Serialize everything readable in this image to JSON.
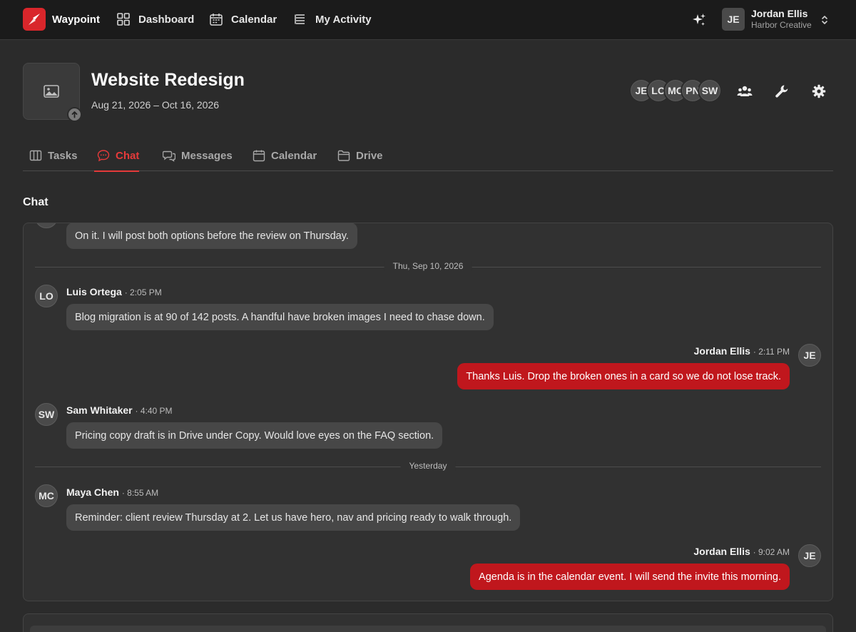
{
  "app": {
    "name": "Waypoint"
  },
  "nav": {
    "dashboard": "Dashboard",
    "calendar": "Calendar",
    "activity": "My Activity"
  },
  "user": {
    "initials": "JE",
    "name": "Jordan Ellis",
    "org": "Harbor Creative"
  },
  "project": {
    "title": "Website Redesign",
    "dates": "Aug 21, 2026 – Oct 16, 2026",
    "members": [
      "JE",
      "LO",
      "MC",
      "PN",
      "SW"
    ]
  },
  "tabs": [
    {
      "label": "Tasks",
      "icon": "columns-icon"
    },
    {
      "label": "Chat",
      "icon": "chat-icon",
      "active": true
    },
    {
      "label": "Messages",
      "icon": "messages-icon"
    },
    {
      "label": "Calendar",
      "icon": "calendar-icon"
    },
    {
      "label": "Drive",
      "icon": "folder-icon"
    }
  ],
  "chat": {
    "title": "Chat",
    "messages": [
      {
        "text": "On it. I will post both options before the review on Thursday."
      },
      {
        "divider": "Thu, Sep 10, 2026"
      },
      {
        "initials": "LO",
        "author": "Luis Ortega",
        "time": "· 2:05 PM",
        "text": "Blog migration is at 90 of 142 posts. A handful have broken images I need to chase down."
      },
      {
        "initials": "JE",
        "author": "Jordan Ellis",
        "time": "· 2:11 PM",
        "text": "Thanks Luis. Drop the broken ones in a card so we do not lose track.",
        "mine": true
      },
      {
        "initials": "SW",
        "author": "Sam Whitaker",
        "time": "· 4:40 PM",
        "text": "Pricing copy draft is in Drive under Copy. Would love eyes on the FAQ section."
      },
      {
        "divider": "Yesterday"
      },
      {
        "initials": "MC",
        "author": "Maya Chen",
        "time": "· 8:55 AM",
        "text": "Reminder: client review Thursday at 2. Let us have hero, nav and pricing ready to walk through."
      },
      {
        "initials": "JE",
        "author": "Jordan Ellis",
        "time": "· 9:02 AM",
        "text": "Agenda is in the calendar event. I will send the invite this morning.",
        "mine": true
      }
    ]
  },
  "colors": {
    "accent": "#c0171d",
    "tab_active": "#e53a3a",
    "background": "#2b2b2b",
    "topbar": "#1b1b1b"
  }
}
